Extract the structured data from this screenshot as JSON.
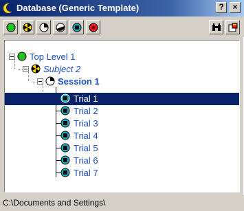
{
  "window": {
    "title": "Database (Generic Template)",
    "help_label": "?",
    "close_label": "×"
  },
  "toolbar": {
    "buttons": [
      {
        "name": "add-top-level-button",
        "icon": "green-circle-icon"
      },
      {
        "name": "add-subject-button",
        "icon": "subject-icon"
      },
      {
        "name": "add-session-button",
        "icon": "session-icon"
      },
      {
        "name": "add-split-button",
        "icon": "split-circle-icon"
      },
      {
        "name": "add-trial-button",
        "icon": "trial-icon"
      },
      {
        "name": "record-button",
        "icon": "red-record-icon"
      },
      {
        "name": "find-button",
        "icon": "binoculars-icon"
      },
      {
        "name": "properties-button",
        "icon": "properties-icon"
      }
    ]
  },
  "tree": {
    "top_level": {
      "label": "Top Level 1",
      "icon": "green-circle-icon"
    },
    "subject": {
      "label": "Subject 2",
      "icon": "subject-icon"
    },
    "session": {
      "label": "Session 1",
      "icon": "session-icon"
    },
    "trials": [
      {
        "label": "Trial 1",
        "selected": true
      },
      {
        "label": "Trial 2",
        "selected": false
      },
      {
        "label": "Trial 3",
        "selected": false
      },
      {
        "label": "Trial 4",
        "selected": false
      },
      {
        "label": "Trial 5",
        "selected": false
      },
      {
        "label": "Trial 6",
        "selected": false
      },
      {
        "label": "Trial 7",
        "selected": false
      }
    ]
  },
  "status": {
    "path": "C:\\Documents and Settings\\"
  },
  "colors": {
    "title_bar": "#0a246a",
    "selection": "#0a246a",
    "tree_text": "#1a4cc8",
    "trial_icon": "#14b4c8",
    "top_level_icon": "#22c022",
    "record_icon": "#e01010"
  }
}
